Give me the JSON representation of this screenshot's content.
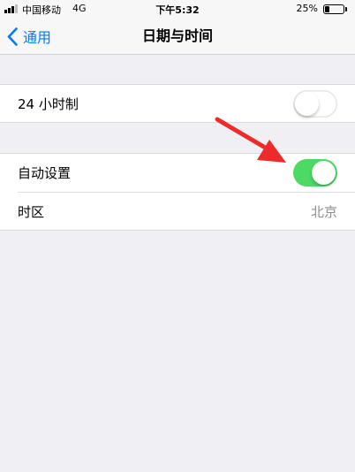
{
  "status_bar": {
    "carrier": "中国移动",
    "network": "4G",
    "time": "下午5:32",
    "battery_percent": "25%",
    "battery_level": 0.25
  },
  "nav": {
    "back_label": "通用",
    "title": "日期与时间"
  },
  "settings": {
    "hour24": {
      "label": "24 小时制",
      "enabled": false
    },
    "auto_set": {
      "label": "自动设置",
      "enabled": true
    },
    "timezone": {
      "label": "时区",
      "value": "北京"
    }
  },
  "colors": {
    "accent": "#007aff",
    "toggle_on": "#4cd964",
    "annotation_arrow": "#ee2b2b",
    "background": "#efeff4"
  },
  "icons": {
    "back": "chevron-left-icon",
    "signal": "signal-bars-icon",
    "battery": "battery-icon",
    "annotation": "red-arrow-icon"
  }
}
